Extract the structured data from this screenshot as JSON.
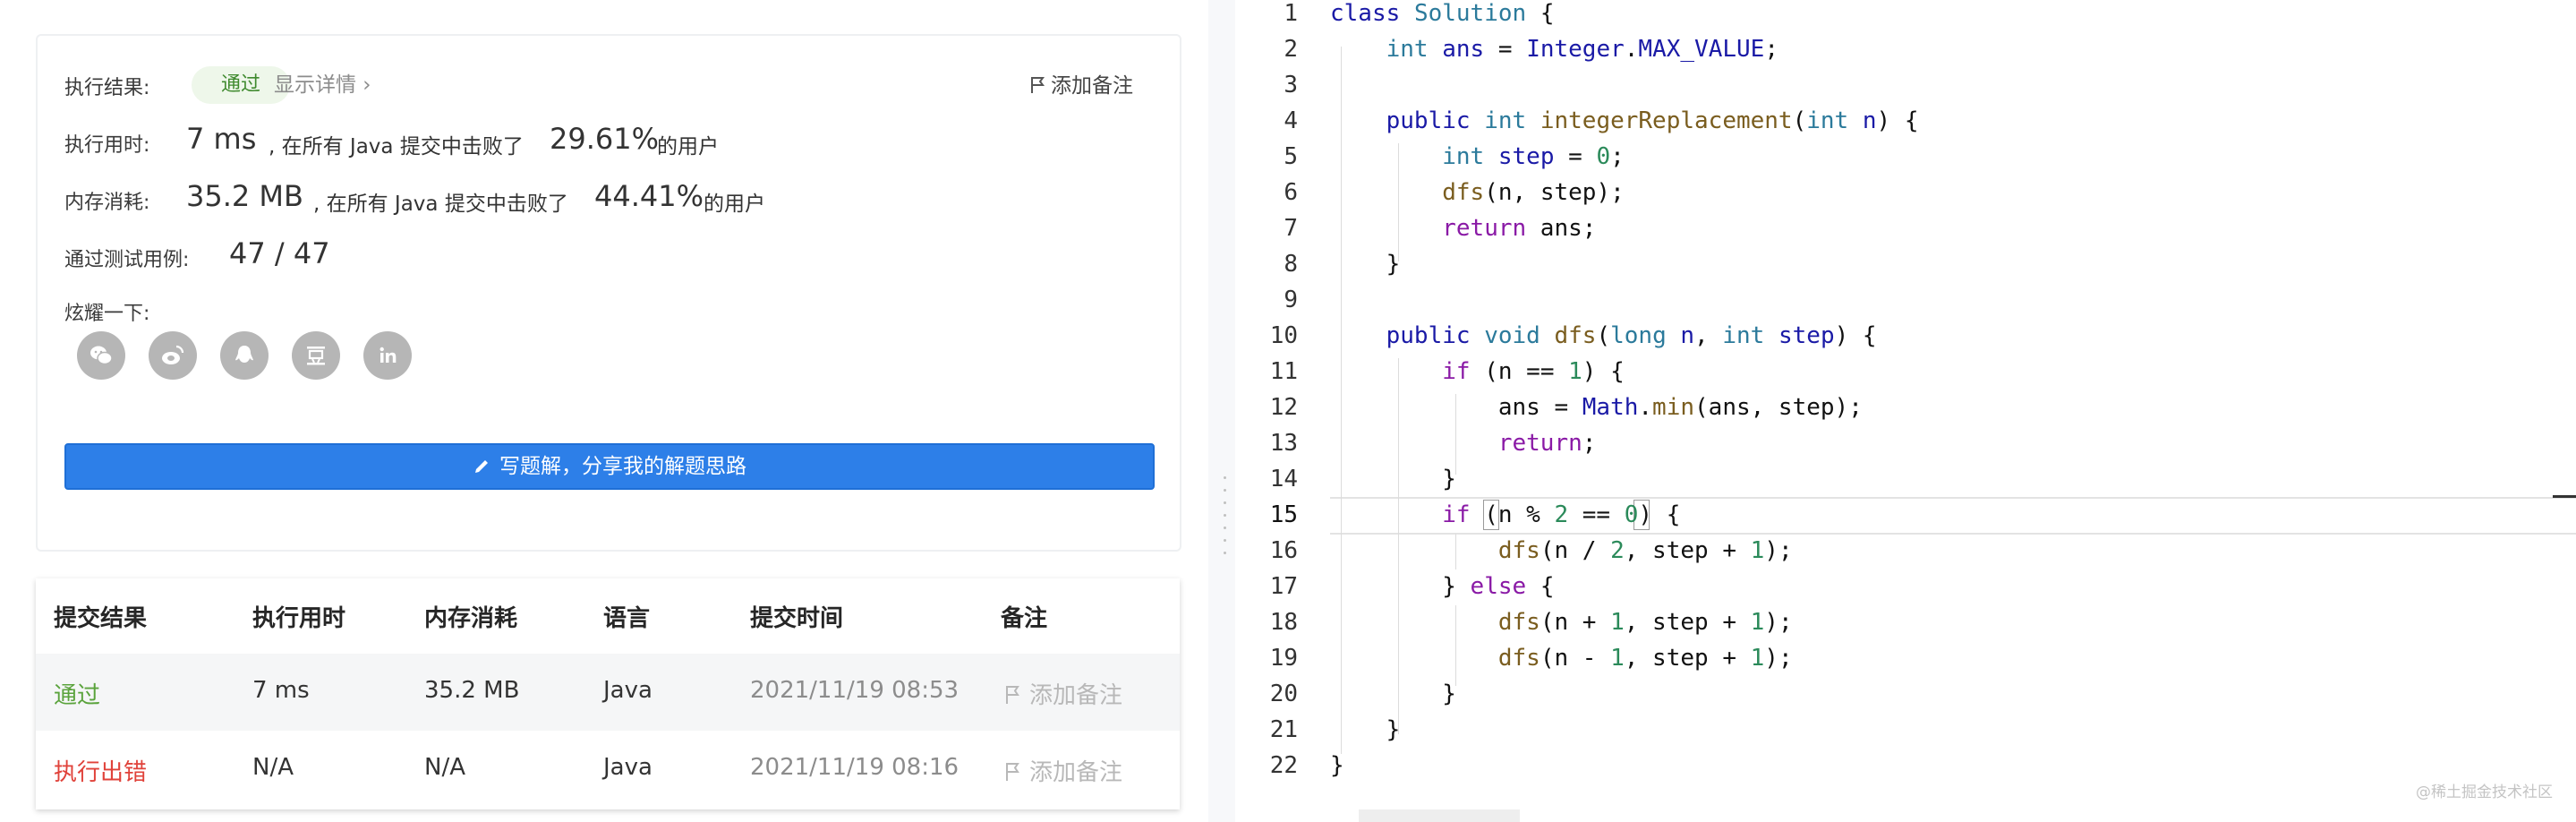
{
  "result": {
    "status_label": "执行结果:",
    "status_badge": "通过",
    "detail_link": "显示详情 ›",
    "add_note": "添加备注",
    "runtime_label": "执行用时:",
    "runtime_value": "7 ms",
    "runtime_text": ", 在所有 Java 提交中击败了",
    "runtime_percent": "29.61%",
    "runtime_suffix": "的用户",
    "memory_label": "内存消耗:",
    "memory_value": "35.2 MB",
    "memory_text": ", 在所有 Java 提交中击败了",
    "memory_percent": "44.41%",
    "memory_suffix": "的用户",
    "tests_label": "通过测试用例:",
    "tests_value": "47 / 47",
    "share_label": "炫耀一下:",
    "share_icons": [
      "wechat-icon",
      "weibo-icon",
      "qq-icon",
      "douban-icon",
      "linkedin-icon"
    ],
    "solution_button": "写题解，分享我的解题思路"
  },
  "submissions": {
    "headers": [
      "提交结果",
      "执行用时",
      "内存消耗",
      "语言",
      "提交时间",
      "备注"
    ],
    "rows": [
      {
        "status": "通过",
        "status_color": "#5aa33c",
        "runtime": "7 ms",
        "memory": "35.2 MB",
        "language": "Java",
        "time": "2021/11/19 08:53",
        "note": "添加备注"
      },
      {
        "status": "执行出错",
        "status_color": "#e0423a",
        "runtime": "N/A",
        "memory": "N/A",
        "language": "Java",
        "time": "2021/11/19 08:16",
        "note": "添加备注"
      }
    ]
  },
  "editor": {
    "line_numbers": [
      "1",
      "2",
      "3",
      "4",
      "5",
      "6",
      "7",
      "8",
      "9",
      "10",
      "11",
      "12",
      "13",
      "14",
      "15",
      "16",
      "17",
      "18",
      "19",
      "20",
      "21",
      "22"
    ],
    "active_line": "15"
  },
  "colors": {
    "accent": "#2d7fe8",
    "pass": "#5aa33c",
    "error": "#e0423a"
  },
  "watermark": "@稀土掘金技术社区"
}
